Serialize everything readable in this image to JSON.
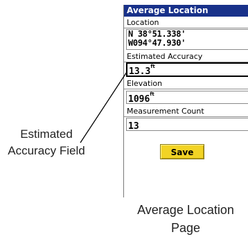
{
  "screen": {
    "title": "Average Location",
    "location_label": "Location",
    "location_lat": "N 38°51.338'",
    "location_lon": "W094°47.930'",
    "accuracy_label": "Estimated Accuracy",
    "accuracy_value": "13.3",
    "accuracy_unit": "ft",
    "elevation_label": "Elevation",
    "elevation_value": "1096",
    "elevation_unit": "ft",
    "count_label": "Measurement Count",
    "count_value": "13",
    "save_label": "Save"
  },
  "captions": {
    "field_line1": "Estimated",
    "field_line2": "Accuracy Field",
    "page_line1": "Average Location",
    "page_line2": "Page"
  },
  "colors": {
    "titlebar": "#18318a",
    "save_button": "#f2d325"
  }
}
